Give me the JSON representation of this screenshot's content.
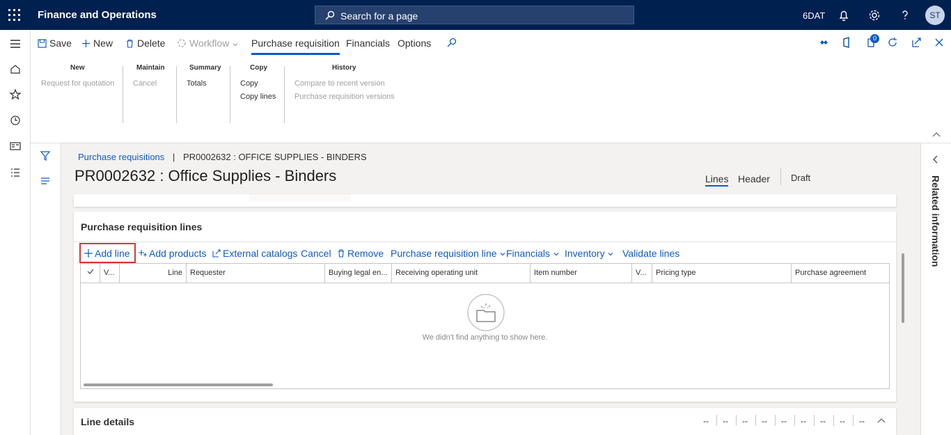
{
  "topbar": {
    "app_title": "Finance and Operations",
    "search_placeholder": "Search for a page",
    "company": "6DAT",
    "user_initials": "ST"
  },
  "actions": {
    "save": "Save",
    "new": "New",
    "delete": "Delete",
    "workflow": "Workflow",
    "tabs": [
      "Purchase requisition",
      "Financials",
      "Options"
    ],
    "notification_count": "0"
  },
  "ribbon": {
    "groups": [
      {
        "title": "New",
        "items": [
          "Request for quotation"
        ]
      },
      {
        "title": "Maintain",
        "items": [
          "Cancel"
        ]
      },
      {
        "title": "Summary",
        "items": [
          "Totals"
        ]
      },
      {
        "title": "Copy",
        "items": [
          "Copy",
          "Copy lines"
        ]
      },
      {
        "title": "History",
        "items": [
          "Compare to recent version",
          "Purchase requisition versions"
        ]
      }
    ]
  },
  "breadcrumb": {
    "parent": "Purchase requisitions",
    "separator": "|",
    "current": "PR0002632 : OFFICE SUPPLIES - BINDERS"
  },
  "page_title": "PR0002632 : Office Supplies - Binders",
  "view_tabs": [
    "Lines",
    "Header"
  ],
  "status": "Draft",
  "lines_section": {
    "title": "Purchase requisition lines",
    "toolbar": [
      "Add line",
      "Add products",
      "External catalogs",
      "Cancel",
      "Remove",
      "Purchase requisition line",
      "Financials",
      "Inventory",
      "Validate lines"
    ],
    "columns": [
      "V...",
      "Line",
      "Requester",
      "Buying legal en...",
      "Receiving operating unit",
      "Item number",
      "V...",
      "Pricing type",
      "Purchase agreement"
    ],
    "empty_message": "We didn't find anything to show here."
  },
  "line_details": {
    "title": "Line details",
    "placeholder": "--"
  },
  "related_information": "Related information"
}
